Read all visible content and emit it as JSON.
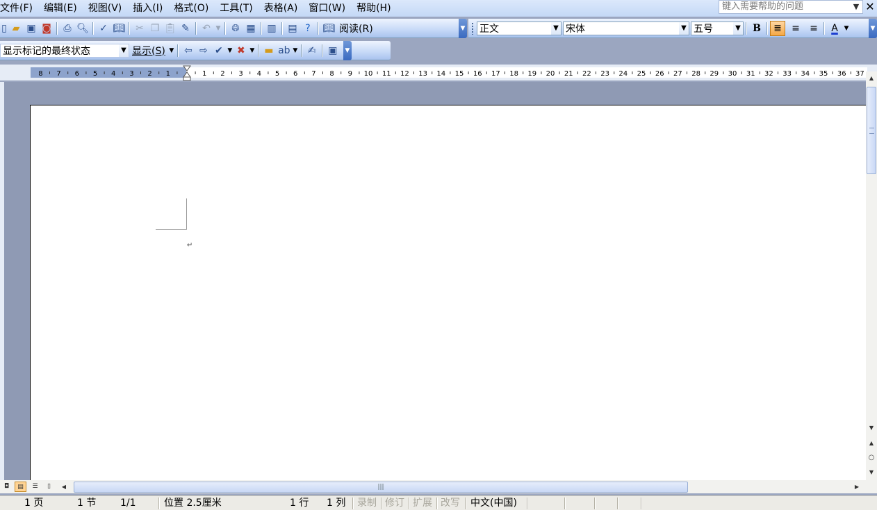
{
  "menubar": {
    "items": [
      "文件(F)",
      "编辑(E)",
      "视图(V)",
      "插入(I)",
      "格式(O)",
      "工具(T)",
      "表格(A)",
      "窗口(W)",
      "帮助(H)"
    ],
    "help_placeholder": "键入需要帮助的问题",
    "close_glyph": "✕"
  },
  "toolbar_standard": {
    "read_label": "阅读(R)"
  },
  "toolbar_formatting": {
    "style_value": "正文",
    "font_value": "宋体",
    "size_value": "五号",
    "bold_label": "B",
    "font_color_label": "A"
  },
  "toolbar_review": {
    "markup_value": "显示标记的最终状态",
    "show_label": "显示(S)"
  },
  "ruler": {
    "left_numbers": [
      "8",
      "7",
      "6",
      "5",
      "4",
      "3",
      "2",
      "1"
    ],
    "right_numbers": [
      "1",
      "2",
      "3",
      "4",
      "5",
      "6",
      "7",
      "8",
      "9",
      "10",
      "11",
      "12",
      "13",
      "14",
      "15",
      "16",
      "17",
      "18",
      "19",
      "20",
      "21",
      "22",
      "23",
      "24",
      "25",
      "26",
      "27",
      "28",
      "29",
      "30",
      "31",
      "32",
      "33",
      "34",
      "35",
      "36",
      "37"
    ]
  },
  "document": {
    "paragraph_mark": "↵"
  },
  "statusbar": {
    "page": "1 页",
    "section": "1 节",
    "page_of": "1/1",
    "position": "位置 2.5厘米",
    "line": "1 行",
    "column": "1 列",
    "record": "录制",
    "track": "修订",
    "extend": "扩展",
    "overtype": "改写",
    "language": "中文(中国)"
  },
  "colors": {
    "menubar": "#c4d8f6",
    "toolbar": "#c6d9f7",
    "workspace": "#8f9ab4",
    "active_button": "#f5a845"
  }
}
